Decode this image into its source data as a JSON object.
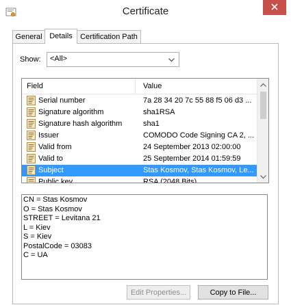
{
  "window": {
    "title": "Certificate",
    "close_icon": "close-icon"
  },
  "tabs": [
    {
      "label": "General"
    },
    {
      "label": "Details",
      "active": true
    },
    {
      "label": "Certification Path"
    }
  ],
  "show": {
    "label": "Show:",
    "selected": "<All>"
  },
  "fields_table": {
    "columns": [
      "Field",
      "Value"
    ],
    "rows": [
      {
        "field": "Serial number",
        "value": "7a 28 34 20 7c 55 88 f5 06 d3 ..."
      },
      {
        "field": "Signature algorithm",
        "value": "sha1RSA"
      },
      {
        "field": "Signature hash algorithm",
        "value": "sha1"
      },
      {
        "field": "Issuer",
        "value": "COMODO Code Signing CA 2, ..."
      },
      {
        "field": "Valid from",
        "value": "24 September 2013 02:00:00"
      },
      {
        "field": "Valid to",
        "value": "25 September 2014 01:59:59"
      },
      {
        "field": "Subject",
        "value": "Stas Kosmov, Stas Kosmov, Le...",
        "selected": true
      },
      {
        "field": "Public key",
        "value": "RSA (2048 Bits)"
      }
    ]
  },
  "detail_lines": [
    "CN = Stas Kosmov",
    "O = Stas Kosmov",
    "STREET = Levitana 21",
    "L = Kiev",
    "S = Kiev",
    "PostalCode = 03083",
    "C = UA"
  ],
  "buttons": {
    "edit_properties": "Edit Properties...",
    "copy_to_file": "Copy to File..."
  },
  "colors": {
    "selection": "#3399ff",
    "close_button": "#c7504b"
  }
}
